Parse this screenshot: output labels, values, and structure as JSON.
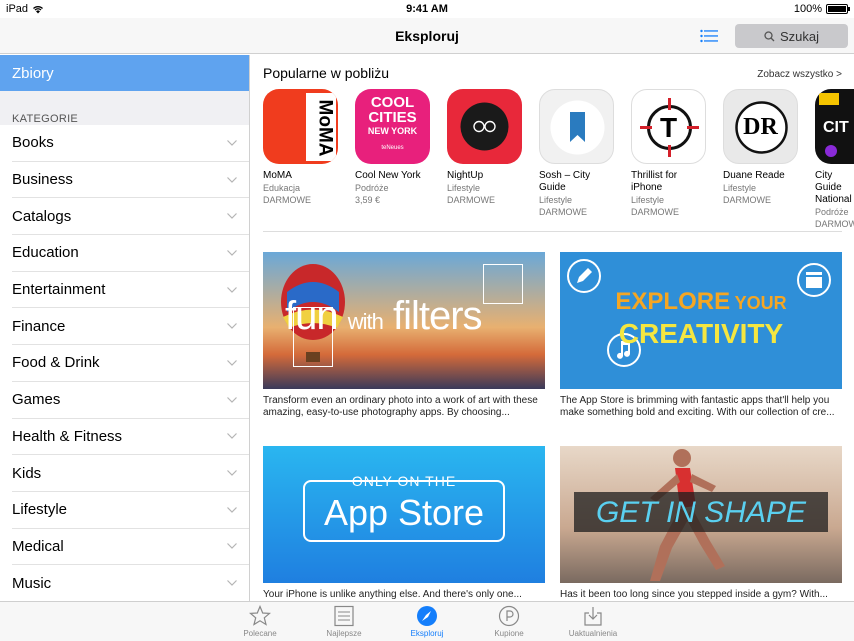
{
  "status": {
    "device": "iPad",
    "time": "9:41 AM",
    "battery": "100%"
  },
  "navbar": {
    "title": "Eksploruj",
    "search_label": "Szukaj"
  },
  "sidebar": {
    "selected": "Zbiory",
    "section_label": "KATEGORIE",
    "items": [
      "Books",
      "Business",
      "Catalogs",
      "Education",
      "Entertainment",
      "Finance",
      "Food & Drink",
      "Games",
      "Health & Fitness",
      "Kids",
      "Lifestyle",
      "Medical",
      "Music"
    ]
  },
  "popular": {
    "heading": "Popularne w pobliżu",
    "see_all": "Zobacz wszystko >",
    "apps": [
      {
        "name": "MoMA",
        "category": "Edukacja",
        "price": "DARMOWE",
        "icon_text": "MoMA",
        "color": "#f03c1e"
      },
      {
        "name": "Cool New York",
        "category": "Podróże",
        "price": "3,59 €",
        "icon_text1": "COOL",
        "icon_text2": "CITIES",
        "icon_text3": "NEW YORK",
        "icon_brand": "teNeues",
        "color": "#e8207c"
      },
      {
        "name": "NightUp",
        "category": "Lifestyle",
        "price": "DARMOWE",
        "color": "#e8283a"
      },
      {
        "name": "Sosh – City Guide",
        "category": "Lifestyle",
        "price": "DARMOWE",
        "color": "#f1f1f1"
      },
      {
        "name": "Thrillist for iPhone",
        "category": "Lifestyle",
        "price": "DARMOWE",
        "icon_text": "T",
        "color": "#ffffff"
      },
      {
        "name": "Duane Reade",
        "category": "Lifestyle",
        "price": "DARMOWE",
        "icon_text": "DR",
        "color": "#e9e9e9"
      },
      {
        "name": "City Guide National",
        "category": "Podróże",
        "price": "DARMOWE",
        "icon_text": "CIT",
        "color": "#111111"
      }
    ]
  },
  "banners": [
    {
      "title_a": "fun",
      "title_b": "with",
      "title_c": "filters",
      "desc": "Transform even an ordinary photo into a work of art with these amazing, easy-to-use photography apps. By choosing..."
    },
    {
      "title_a": "EXPLORE",
      "title_b": "YOUR",
      "title_c": "CREATIVITY",
      "desc": "The App Store is brimming with fantastic apps that'll help you make something bold and exciting. With our collection of cre..."
    },
    {
      "title_a": "ONLY ON THE",
      "title_b": "App Store",
      "desc": "Your iPhone is unlike anything else. And there's only one..."
    },
    {
      "title_a": "GET IN SHAPE",
      "desc": "Has it been too long since you stepped inside a gym? With..."
    }
  ],
  "tabs": [
    {
      "label": "Polecane",
      "icon": "star-icon"
    },
    {
      "label": "Najlepsze",
      "icon": "list-icon"
    },
    {
      "label": "Eksploruj",
      "icon": "compass-icon"
    },
    {
      "label": "Kupione",
      "icon": "purchased-icon"
    },
    {
      "label": "Uaktualnienia",
      "icon": "download-icon"
    }
  ],
  "colors": {
    "accent": "#147efb",
    "selected_row": "#5fa3ef"
  }
}
